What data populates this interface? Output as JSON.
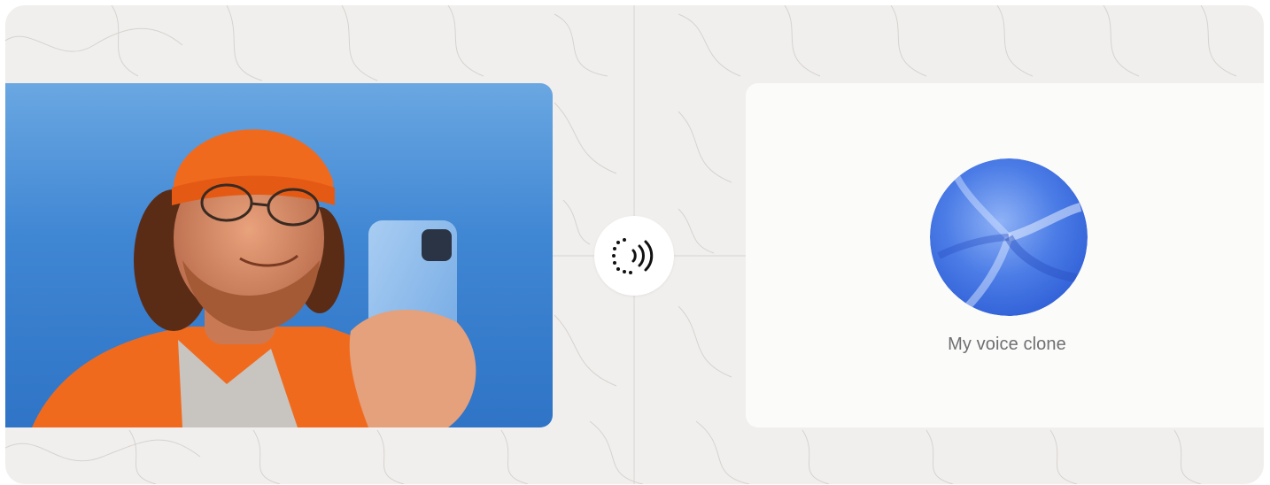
{
  "voice_card": {
    "label": "My voice clone"
  },
  "center_button": {
    "icon": "voice-clone-waves-icon"
  },
  "photo": {
    "description_icon": "person-photo"
  },
  "colors": {
    "background": "#f1efed",
    "card": "#fbfbfa",
    "photo_sky": "#3f86d3",
    "orange": "#f06a1e",
    "orb_blue": "#3f6fe0",
    "label_text": "#6f6f72"
  }
}
